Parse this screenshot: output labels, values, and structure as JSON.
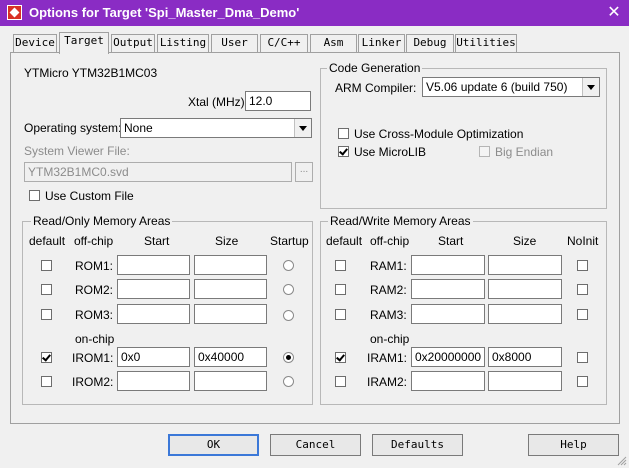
{
  "window": {
    "title": "Options for Target 'Spi_Master_Dma_Demo'",
    "close": "✕"
  },
  "tabs": [
    "Device",
    "Target",
    "Output",
    "Listing",
    "User",
    "C/C++",
    "Asm",
    "Linker",
    "Debug",
    "Utilities"
  ],
  "target": {
    "device_name": "YTMicro YTM32B1MC03",
    "xtal_label": "Xtal (MHz):",
    "xtal_value": "12.0",
    "os_label": "Operating system:",
    "os_value": "None",
    "svd_label": "System Viewer File:",
    "svd_value": "YTM32B1MC0.svd",
    "browse_label": "...",
    "custom_file_label": "Use Custom File"
  },
  "codegen": {
    "group_label": "Code Generation",
    "compiler_label": "ARM Compiler:",
    "compiler_value": "V5.06 update 6 (build 750)",
    "cross_module_label": "Use Cross-Module Optimization",
    "microlib_label": "Use MicroLIB",
    "big_endian_label": "Big Endian"
  },
  "rom": {
    "group_label": "Read/Only Memory Areas",
    "headers": {
      "default": "default",
      "offchip": "off-chip",
      "start": "Start",
      "size": "Size",
      "startup": "Startup"
    },
    "onchip_label": "on-chip",
    "rows": [
      {
        "name": "ROM1:",
        "start": "",
        "size": ""
      },
      {
        "name": "ROM2:",
        "start": "",
        "size": ""
      },
      {
        "name": "ROM3:",
        "start": "",
        "size": ""
      },
      {
        "name": "IROM1:",
        "start": "0x0",
        "size": "0x40000"
      },
      {
        "name": "IROM2:",
        "start": "",
        "size": ""
      }
    ]
  },
  "ram": {
    "group_label": "Read/Write Memory Areas",
    "headers": {
      "default": "default",
      "offchip": "off-chip",
      "start": "Start",
      "size": "Size",
      "noinit": "NoInit"
    },
    "onchip_label": "on-chip",
    "rows": [
      {
        "name": "RAM1:",
        "start": "",
        "size": ""
      },
      {
        "name": "RAM2:",
        "start": "",
        "size": ""
      },
      {
        "name": "RAM3:",
        "start": "",
        "size": ""
      },
      {
        "name": "IRAM1:",
        "start": "0x20000000",
        "size": "0x8000"
      },
      {
        "name": "IRAM2:",
        "start": "",
        "size": ""
      }
    ]
  },
  "buttons": {
    "ok": "OK",
    "cancel": "Cancel",
    "defaults": "Defaults",
    "help": "Help"
  }
}
